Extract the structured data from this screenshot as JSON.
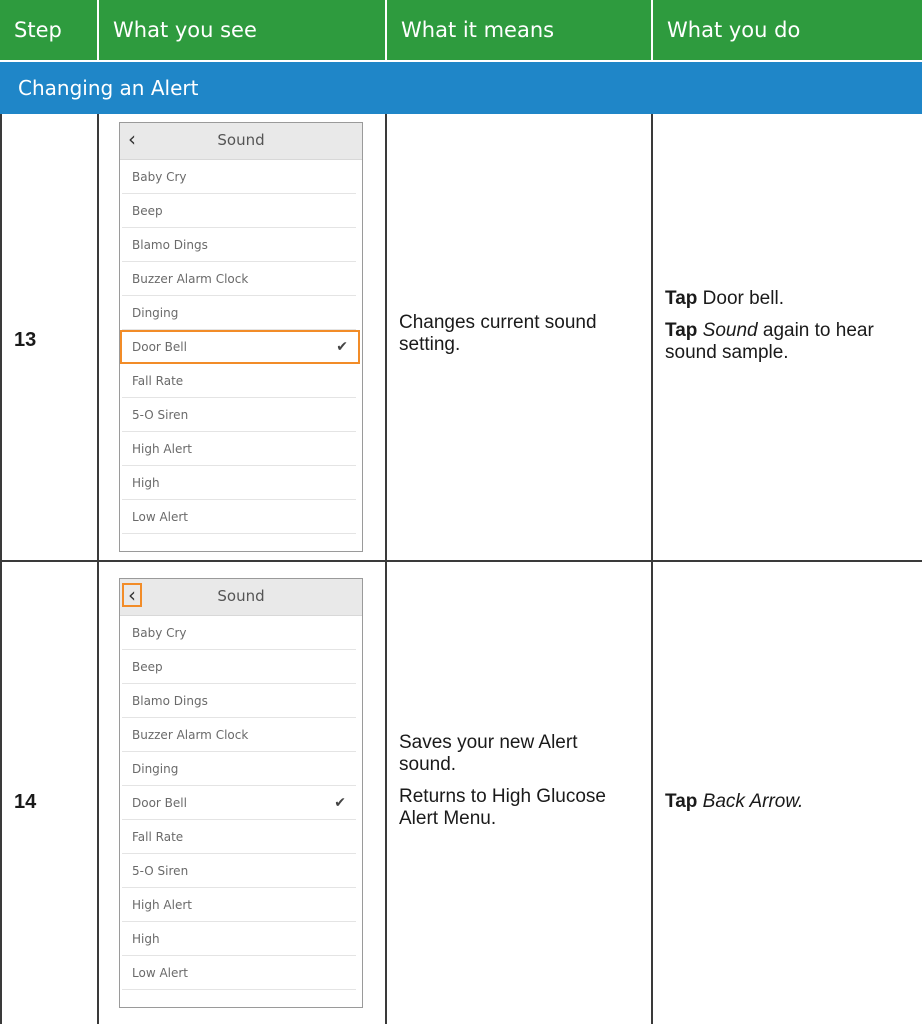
{
  "header": {
    "step": "Step",
    "see": "What you see",
    "means": "What it means",
    "do": "What you do"
  },
  "section_title": "Changing an Alert",
  "phone": {
    "title": "Sound",
    "items": [
      "Baby Cry",
      "Beep",
      "Blamo Dings",
      "Buzzer Alarm Clock",
      "Dinging",
      "Door Bell",
      "Fall Rate",
      "5-O Siren",
      "High Alert",
      "High",
      "Low Alert"
    ],
    "selected": "Door Bell"
  },
  "rows": [
    {
      "step": "13",
      "means": [
        "Changes current sound setting."
      ],
      "do": [
        {
          "bold": "Tap",
          "plain": " Door bell.",
          "italic": ""
        },
        {
          "bold": "Tap",
          "italic": "Sound",
          "plain": " again to hear sound sample."
        }
      ]
    },
    {
      "step": "14",
      "means": [
        "Saves your new Alert sound.",
        "Returns to High Glucose Alert Menu."
      ],
      "do": [
        {
          "bold": "Tap",
          "italic": "Back Arrow.",
          "plain": ""
        }
      ]
    }
  ],
  "colors": {
    "header_bg": "#2e9b3e",
    "section_bg": "#1f86c8",
    "highlight": "#f28c28"
  },
  "icons": {
    "back": "chevron-left-icon",
    "check": "checkmark-icon"
  }
}
